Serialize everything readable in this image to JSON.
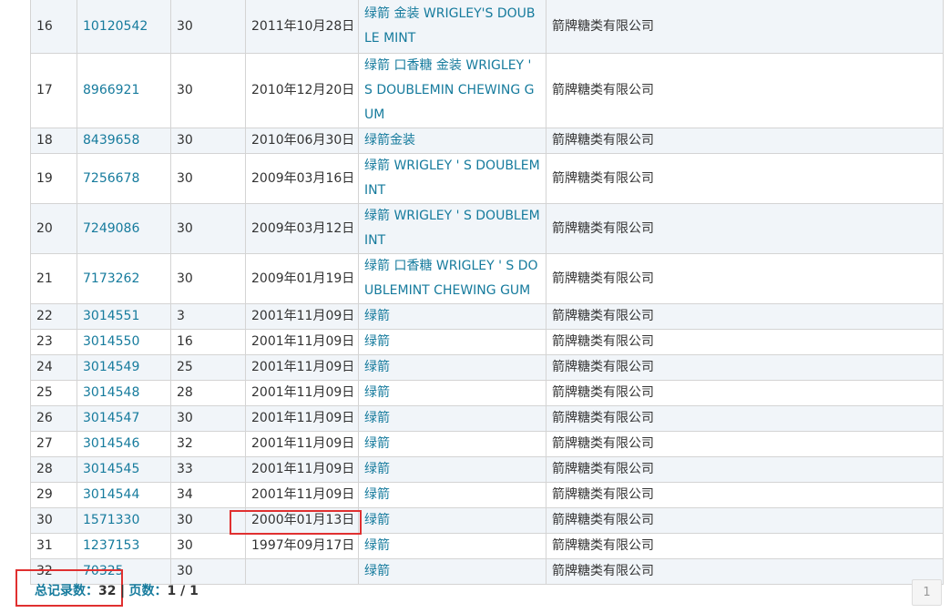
{
  "rows": [
    {
      "no": "16",
      "reg": "10120542",
      "cls": "30",
      "date": "2011年10月28日",
      "name": "绿箭 金装 WRIGLEY'S DOUBLE MINT",
      "owner": "箭牌糖类有限公司"
    },
    {
      "no": "17",
      "reg": "8966921",
      "cls": "30",
      "date": "2010年12月20日",
      "name": "绿箭 口香糖 金装 WRIGLEY ' S DOUBLEMIN CHEWING GUM",
      "owner": "箭牌糖类有限公司"
    },
    {
      "no": "18",
      "reg": "8439658",
      "cls": "30",
      "date": "2010年06月30日",
      "name": "绿箭金装",
      "owner": "箭牌糖类有限公司"
    },
    {
      "no": "19",
      "reg": "7256678",
      "cls": "30",
      "date": "2009年03月16日",
      "name": "绿箭 WRIGLEY ' S DOUBLEMINT",
      "owner": "箭牌糖类有限公司"
    },
    {
      "no": "20",
      "reg": "7249086",
      "cls": "30",
      "date": "2009年03月12日",
      "name": "绿箭 WRIGLEY ' S DOUBLEMINT",
      "owner": "箭牌糖类有限公司"
    },
    {
      "no": "21",
      "reg": "7173262",
      "cls": "30",
      "date": "2009年01月19日",
      "name": "绿箭 口香糖 WRIGLEY ' S DOUBLEMINT CHEWING GUM",
      "owner": "箭牌糖类有限公司"
    },
    {
      "no": "22",
      "reg": "3014551",
      "cls": "3",
      "date": "2001年11月09日",
      "name": "绿箭",
      "owner": "箭牌糖类有限公司"
    },
    {
      "no": "23",
      "reg": "3014550",
      "cls": "16",
      "date": "2001年11月09日",
      "name": "绿箭",
      "owner": "箭牌糖类有限公司"
    },
    {
      "no": "24",
      "reg": "3014549",
      "cls": "25",
      "date": "2001年11月09日",
      "name": "绿箭",
      "owner": "箭牌糖类有限公司"
    },
    {
      "no": "25",
      "reg": "3014548",
      "cls": "28",
      "date": "2001年11月09日",
      "name": "绿箭",
      "owner": "箭牌糖类有限公司"
    },
    {
      "no": "26",
      "reg": "3014547",
      "cls": "30",
      "date": "2001年11月09日",
      "name": "绿箭",
      "owner": "箭牌糖类有限公司"
    },
    {
      "no": "27",
      "reg": "3014546",
      "cls": "32",
      "date": "2001年11月09日",
      "name": "绿箭",
      "owner": "箭牌糖类有限公司"
    },
    {
      "no": "28",
      "reg": "3014545",
      "cls": "33",
      "date": "2001年11月09日",
      "name": "绿箭",
      "owner": "箭牌糖类有限公司"
    },
    {
      "no": "29",
      "reg": "3014544",
      "cls": "34",
      "date": "2001年11月09日",
      "name": "绿箭",
      "owner": "箭牌糖类有限公司"
    },
    {
      "no": "30",
      "reg": "1571330",
      "cls": "30",
      "date": "2000年01月13日",
      "name": "绿箭",
      "owner": "箭牌糖类有限公司"
    },
    {
      "no": "31",
      "reg": "1237153",
      "cls": "30",
      "date": "1997年09月17日",
      "name": "绿箭",
      "owner": "箭牌糖类有限公司"
    },
    {
      "no": "32",
      "reg": "70325",
      "cls": "30",
      "date": "",
      "name": "绿箭",
      "owner": "箭牌糖类有限公司"
    }
  ],
  "footer": {
    "total_label": "总记录数：",
    "total_value": "32",
    "separator": "|",
    "pages_label": "页数：",
    "pages_value": "1 / 1",
    "page_button": "1"
  },
  "colors": {
    "link": "#167b9d",
    "highlight_box": "#e03030",
    "row_stripe": "#f1f5f9"
  }
}
